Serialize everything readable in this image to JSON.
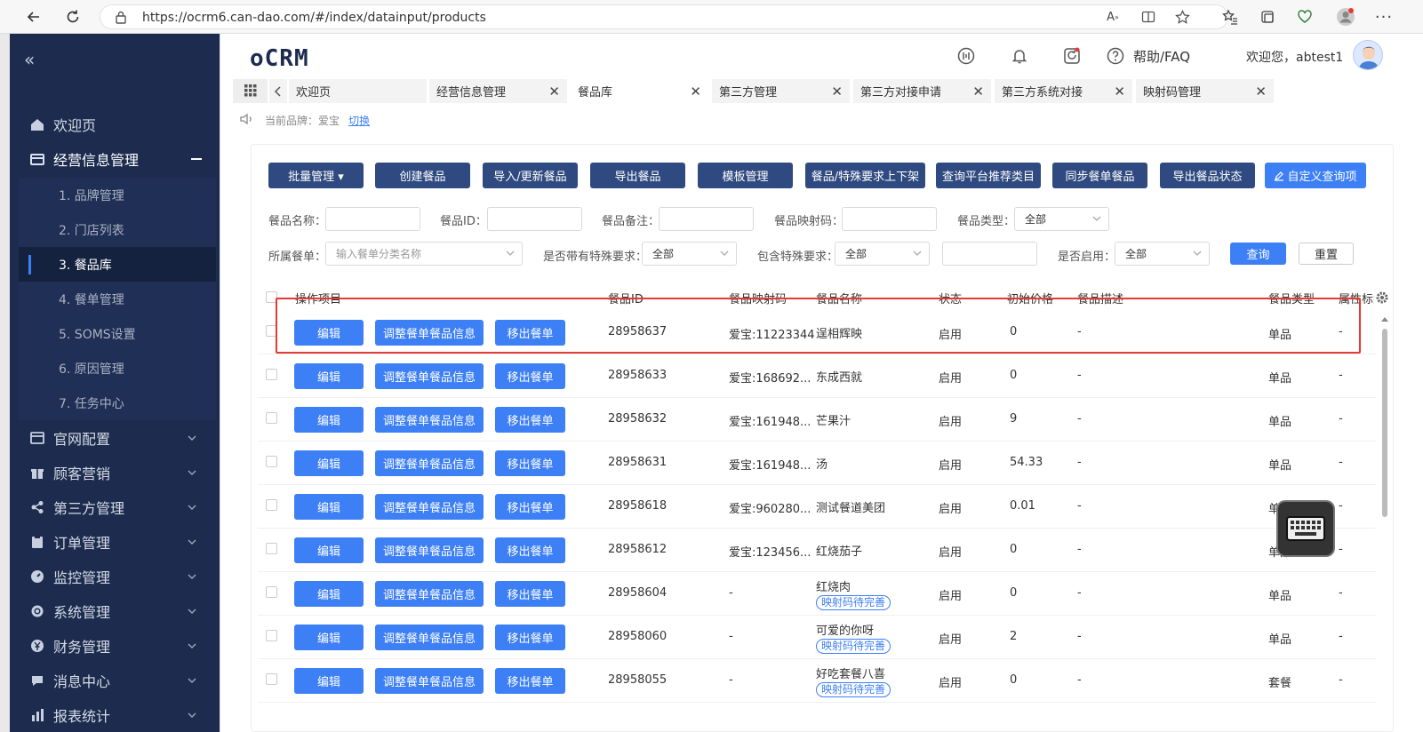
{
  "browser": {
    "url": "https://ocrm6.can-dao.com/#/index/datainput/products"
  },
  "sidebar": {
    "items": [
      {
        "label": "欢迎页",
        "icon": "home-icon",
        "expandable": false
      },
      {
        "label": "经营信息管理",
        "icon": "store-icon",
        "expandable": true,
        "expanded": true
      },
      {
        "label": "官网配置",
        "icon": "browser-window-icon",
        "expandable": true
      },
      {
        "label": "顾客营销",
        "icon": "gift-icon",
        "expandable": true
      },
      {
        "label": "第三方管理",
        "icon": "share-icon",
        "expandable": true
      },
      {
        "label": "订单管理",
        "icon": "clipboard-icon",
        "expandable": true
      },
      {
        "label": "监控管理",
        "icon": "gauge-icon",
        "expandable": true
      },
      {
        "label": "系统管理",
        "icon": "gear-icon",
        "expandable": true
      },
      {
        "label": "财务管理",
        "icon": "yen-icon",
        "expandable": true
      },
      {
        "label": "消息中心",
        "icon": "chat-bubble-icon",
        "expandable": true
      },
      {
        "label": "报表统计",
        "icon": "chart-icon",
        "expandable": true
      }
    ],
    "subitems": [
      {
        "label": "1. 品牌管理",
        "active": false
      },
      {
        "label": "2. 门店列表",
        "active": false
      },
      {
        "label": "3. 餐品库",
        "active": true
      },
      {
        "label": "4. 餐单管理",
        "active": false
      },
      {
        "label": "5. SOMS设置",
        "active": false
      },
      {
        "label": "6. 原因管理",
        "active": false
      },
      {
        "label": "7. 任务中心",
        "active": false
      }
    ]
  },
  "header": {
    "logo": "oCRM",
    "help_label": "帮助/FAQ",
    "welcome": "欢迎您，abtest1"
  },
  "tabs": [
    {
      "label": "欢迎页",
      "closable": false,
      "active": false
    },
    {
      "label": "经营信息管理",
      "closable": true,
      "active": false
    },
    {
      "label": "餐品库",
      "closable": true,
      "active": true
    },
    {
      "label": "第三方管理",
      "closable": true,
      "active": false
    },
    {
      "label": "第三方对接申请",
      "closable": true,
      "active": false
    },
    {
      "label": "第三方系统对接",
      "closable": true,
      "active": false
    },
    {
      "label": "映射码管理",
      "closable": true,
      "active": false
    }
  ],
  "brand_line": {
    "text": "当前品牌：爱宝",
    "switch_label": "切换"
  },
  "toolbar": [
    {
      "label": "批量管理 ▾"
    },
    {
      "label": "创建餐品"
    },
    {
      "label": "导入/更新餐品"
    },
    {
      "label": "导出餐品"
    },
    {
      "label": "模板管理"
    },
    {
      "label": "餐品/特殊要求上下架"
    },
    {
      "label": "查询平台推荐类目"
    },
    {
      "label": "同步餐单餐品"
    },
    {
      "label": "导出餐品状态"
    },
    {
      "label": "自定义查询项"
    }
  ],
  "filters": {
    "name_label": "餐品名称：",
    "id_label": "餐品ID：",
    "note_label": "餐品备注：",
    "map_label": "餐品映射码：",
    "type_label": "餐品类型：",
    "type_value": "全部",
    "menu_label": "所属餐单：",
    "menu_placeholder": "输入餐单分类名称",
    "special_label": "是否带有特殊要求：",
    "special_value": "全部",
    "contains_label": "包含特殊要求：",
    "contains_value": "全部",
    "enabled_label": "是否启用：",
    "enabled_value": "全部",
    "search_label": "查询",
    "reset_label": "重置"
  },
  "table": {
    "columns": [
      "操作项目",
      "餐品ID",
      "餐品映射码",
      "餐品名称",
      "状态",
      "初始价格",
      "餐品描述",
      "餐品类型",
      "属性标签"
    ],
    "action_labels": [
      "编辑",
      "调整餐单餐品信息",
      "移出餐单"
    ],
    "rows": [
      {
        "id": "28958637",
        "map": "爱宝:11223344",
        "name": "逞相辉映",
        "badge": "",
        "status": "启用",
        "price": "0",
        "desc": "-",
        "type": "单品",
        "tag": "-"
      },
      {
        "id": "28958633",
        "map": "爱宝:168692...",
        "name": "东成西就",
        "badge": "",
        "status": "启用",
        "price": "0",
        "desc": "-",
        "type": "单品",
        "tag": "-"
      },
      {
        "id": "28958632",
        "map": "爱宝:161948...",
        "name": "芒果汁",
        "badge": "",
        "status": "启用",
        "price": "9",
        "desc": "-",
        "type": "单品",
        "tag": "-"
      },
      {
        "id": "28958631",
        "map": "爱宝:161948...",
        "name": "汤",
        "badge": "",
        "status": "启用",
        "price": "54.33",
        "desc": "-",
        "type": "单品",
        "tag": "-"
      },
      {
        "id": "28958618",
        "map": "爱宝:960280...",
        "name": "测试餐道美团",
        "badge": "",
        "status": "启用",
        "price": "0.01",
        "desc": "-",
        "type": "单品",
        "tag": "-"
      },
      {
        "id": "28958612",
        "map": "爱宝:123456...",
        "name": "红烧茄子",
        "badge": "",
        "status": "启用",
        "price": "0",
        "desc": "-",
        "type": "单品",
        "tag": "-"
      },
      {
        "id": "28958604",
        "map": "-",
        "name": "红烧肉",
        "badge": "映射码待完善",
        "status": "启用",
        "price": "0",
        "desc": "-",
        "type": "单品",
        "tag": "-"
      },
      {
        "id": "28958060",
        "map": "-",
        "name": "可爱的你呀",
        "badge": "映射码待完善",
        "status": "启用",
        "price": "2",
        "desc": "-",
        "type": "单品",
        "tag": "-"
      },
      {
        "id": "28958055",
        "map": "-",
        "name": "好吃套餐八喜",
        "badge": "映射码待完善",
        "status": "启用",
        "price": "0",
        "desc": "-",
        "type": "套餐",
        "tag": "-"
      }
    ]
  },
  "colors": {
    "sidebar_bg": "#1c2b4e",
    "primary_button": "#2f4a80",
    "action_button": "#3d7ff5",
    "highlight_border": "#e53935"
  }
}
